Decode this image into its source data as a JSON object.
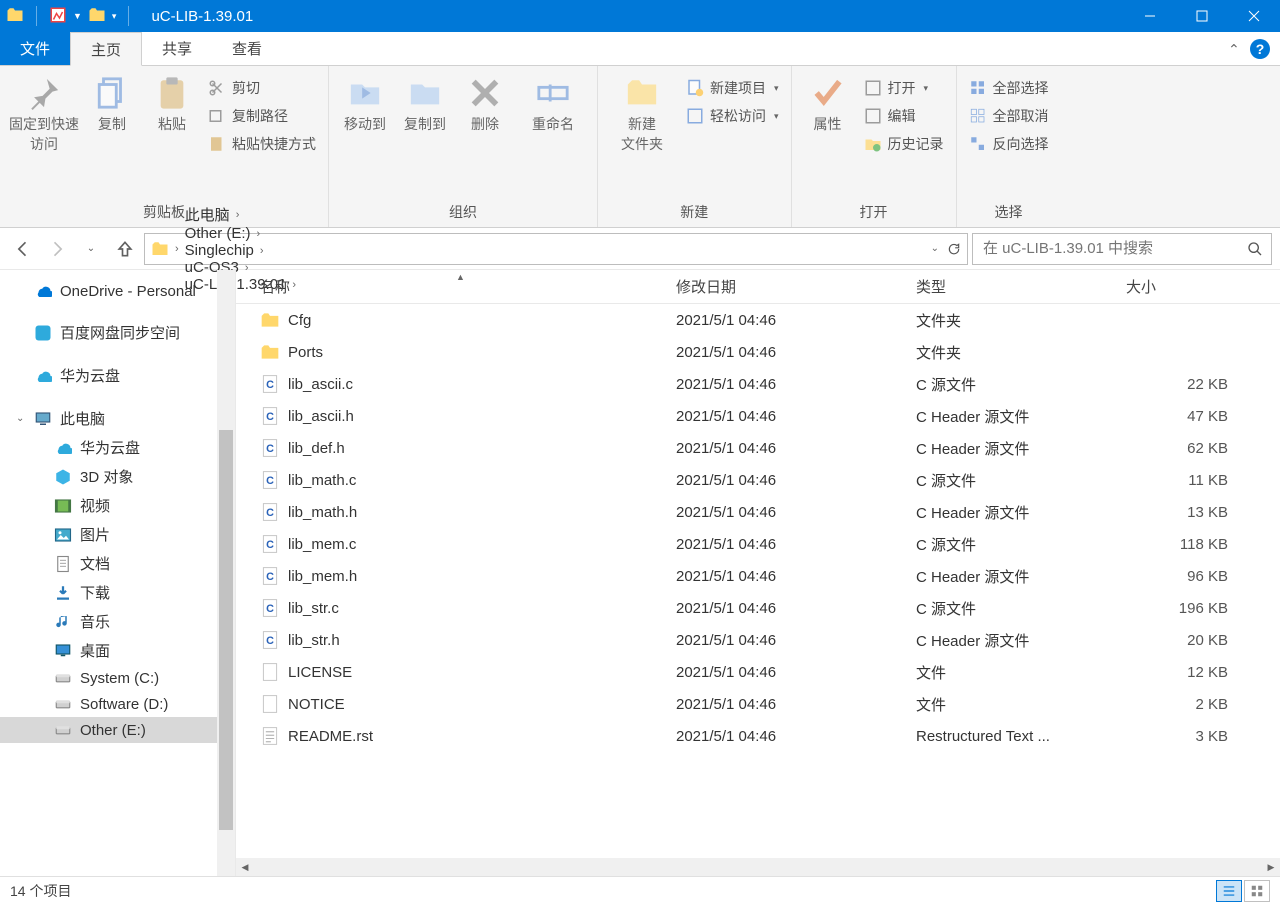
{
  "title": "uC-LIB-1.39.01",
  "tabs": {
    "file": "文件",
    "home": "主页",
    "share": "共享",
    "view": "查看"
  },
  "ribbon": {
    "clipboard": {
      "label": "剪贴板",
      "pin": "固定到快速访问",
      "copy": "复制",
      "paste": "粘贴",
      "cut": "剪切",
      "copypath": "复制路径",
      "pasteshortcut": "粘贴快捷方式"
    },
    "organize": {
      "label": "组织",
      "moveto": "移动到",
      "copyto": "复制到",
      "delete": "删除",
      "rename": "重命名"
    },
    "new": {
      "label": "新建",
      "newfolder": "新建\n文件夹",
      "newitem": "新建项目",
      "easyaccess": "轻松访问"
    },
    "open": {
      "label": "打开",
      "properties": "属性",
      "open": "打开",
      "edit": "编辑",
      "history": "历史记录"
    },
    "select": {
      "label": "选择",
      "selectall": "全部选择",
      "selectnone": "全部取消",
      "invert": "反向选择"
    }
  },
  "breadcrumbs": [
    "此电脑",
    "Other (E:)",
    "Singlechip",
    "uC-OS3",
    "uC-LIB-1.39.01"
  ],
  "search_placeholder": "在 uC-LIB-1.39.01 中搜索",
  "sidebar": {
    "items": [
      {
        "label": "OneDrive - Personal",
        "icon": "onedrive"
      },
      {
        "label": "百度网盘同步空间",
        "icon": "baidu"
      },
      {
        "label": "华为云盘",
        "icon": "huawei"
      },
      {
        "label": "此电脑",
        "icon": "pc",
        "expandable": true
      },
      {
        "label": "华为云盘",
        "icon": "huawei",
        "level": 2
      },
      {
        "label": "3D 对象",
        "icon": "3d",
        "level": 2
      },
      {
        "label": "视频",
        "icon": "video",
        "level": 2
      },
      {
        "label": "图片",
        "icon": "pictures",
        "level": 2
      },
      {
        "label": "文档",
        "icon": "docs",
        "level": 2
      },
      {
        "label": "下载",
        "icon": "downloads",
        "level": 2
      },
      {
        "label": "音乐",
        "icon": "music",
        "level": 2
      },
      {
        "label": "桌面",
        "icon": "desktop",
        "level": 2
      },
      {
        "label": "System (C:)",
        "icon": "drive",
        "level": 2
      },
      {
        "label": "Software (D:)",
        "icon": "drive",
        "level": 2
      },
      {
        "label": "Other (E:)",
        "icon": "drive",
        "level": 2,
        "selected": true
      }
    ]
  },
  "columns": {
    "name": "名称",
    "date": "修改日期",
    "type": "类型",
    "size": "大小"
  },
  "files": [
    {
      "icon": "folder",
      "name": "Cfg",
      "date": "2021/5/1 04:46",
      "type": "文件夹",
      "size": ""
    },
    {
      "icon": "folder",
      "name": "Ports",
      "date": "2021/5/1 04:46",
      "type": "文件夹",
      "size": ""
    },
    {
      "icon": "c",
      "name": "lib_ascii.c",
      "date": "2021/5/1 04:46",
      "type": "C 源文件",
      "size": "22 KB"
    },
    {
      "icon": "c",
      "name": "lib_ascii.h",
      "date": "2021/5/1 04:46",
      "type": "C Header 源文件",
      "size": "47 KB"
    },
    {
      "icon": "c",
      "name": "lib_def.h",
      "date": "2021/5/1 04:46",
      "type": "C Header 源文件",
      "size": "62 KB"
    },
    {
      "icon": "c",
      "name": "lib_math.c",
      "date": "2021/5/1 04:46",
      "type": "C 源文件",
      "size": "11 KB"
    },
    {
      "icon": "c",
      "name": "lib_math.h",
      "date": "2021/5/1 04:46",
      "type": "C Header 源文件",
      "size": "13 KB"
    },
    {
      "icon": "c",
      "name": "lib_mem.c",
      "date": "2021/5/1 04:46",
      "type": "C 源文件",
      "size": "118 KB"
    },
    {
      "icon": "c",
      "name": "lib_mem.h",
      "date": "2021/5/1 04:46",
      "type": "C Header 源文件",
      "size": "96 KB"
    },
    {
      "icon": "c",
      "name": "lib_str.c",
      "date": "2021/5/1 04:46",
      "type": "C 源文件",
      "size": "196 KB"
    },
    {
      "icon": "c",
      "name": "lib_str.h",
      "date": "2021/5/1 04:46",
      "type": "C Header 源文件",
      "size": "20 KB"
    },
    {
      "icon": "file",
      "name": "LICENSE",
      "date": "2021/5/1 04:46",
      "type": "文件",
      "size": "12 KB"
    },
    {
      "icon": "file",
      "name": "NOTICE",
      "date": "2021/5/1 04:46",
      "type": "文件",
      "size": "2 KB"
    },
    {
      "icon": "text",
      "name": "README.rst",
      "date": "2021/5/1 04:46",
      "type": "Restructured Text ...",
      "size": "3 KB"
    }
  ],
  "status": "14 个项目"
}
